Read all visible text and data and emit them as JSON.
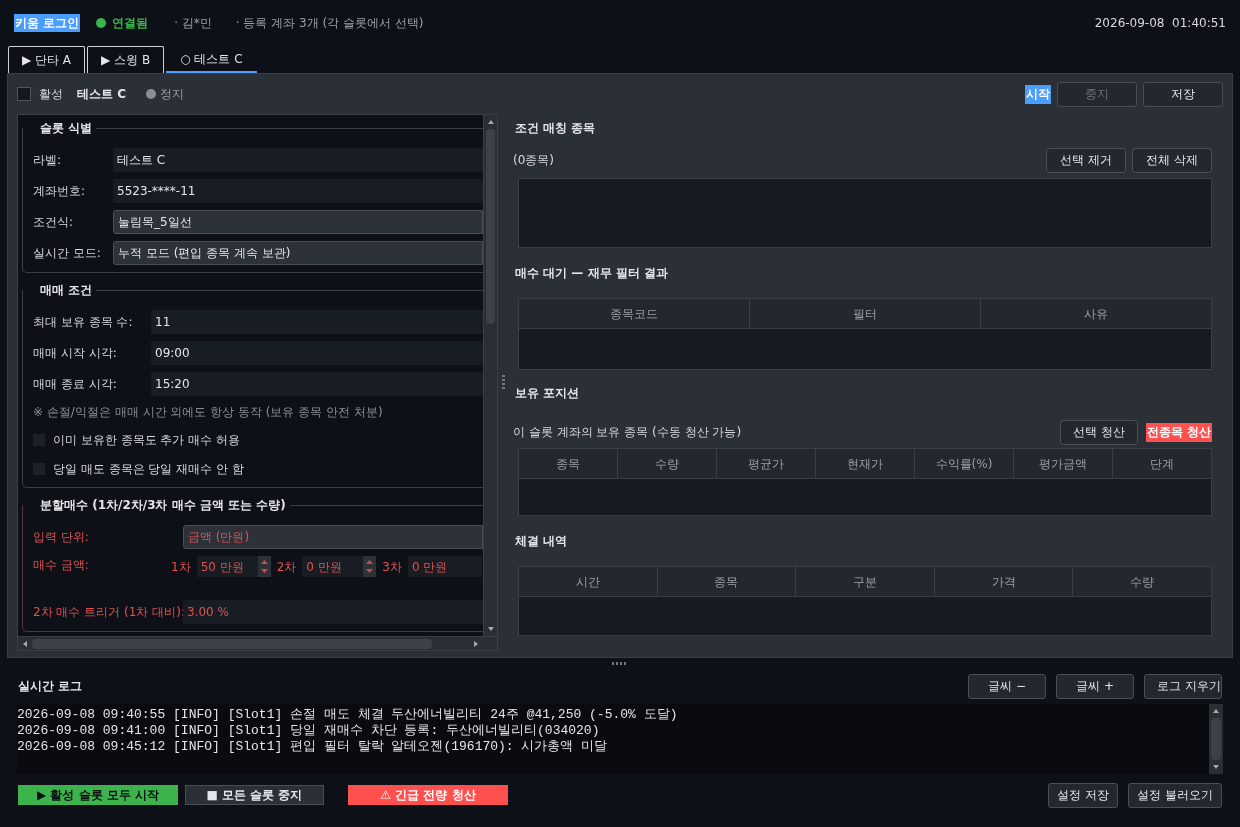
{
  "header": {
    "login_button": "키움 로그인",
    "connection": {
      "label": "연결됨",
      "connected": true
    },
    "user": "· 김*민",
    "accounts": "· 등록 계좌 3개 (각 슬롯에서 선택)",
    "datetime": "2026-09-08  01:40:51"
  },
  "tabs": [
    {
      "label": "▶ 단타 A",
      "selected": false
    },
    {
      "label": "▶ 스윙 B",
      "selected": false
    },
    {
      "label": "○ 테스트 C",
      "selected": true
    }
  ],
  "slot_bar": {
    "active": {
      "label": "활성",
      "checked": false
    },
    "name": "테스트 C",
    "status": {
      "label": "정지",
      "running": false
    },
    "buttons": [
      {
        "label": "시작",
        "kind": "highlight",
        "disabled": false
      },
      {
        "label": "중지",
        "kind": "normal",
        "disabled": true
      },
      {
        "label": "저장",
        "kind": "normal",
        "disabled": false
      }
    ]
  },
  "settings": [
    {
      "title": "슬롯 식별",
      "warning": false,
      "rows": [
        {
          "kind": "field",
          "label": "라벨:",
          "value": "테스트 C",
          "select": false
        },
        {
          "kind": "field",
          "label": "계좌번호:",
          "value": "5523-****-11",
          "select": false
        },
        {
          "kind": "field",
          "label": "조건식:",
          "value": "눌림목_5일선",
          "select": true
        },
        {
          "kind": "field",
          "label": "실시간 모드:",
          "value": "누적 모드 (편입 종목 계속 보관)",
          "select": true
        }
      ]
    },
    {
      "title": "매매 조건",
      "warning": false,
      "rows": [
        {
          "kind": "field",
          "label": "최대 보유 종목 수:",
          "value": "11",
          "select": false
        },
        {
          "kind": "field",
          "label": "매매 시작 시각:",
          "value": "09:00",
          "select": false
        },
        {
          "kind": "field",
          "label": "매매 종료 시각:",
          "value": "15:20",
          "select": false
        },
        {
          "kind": "note",
          "text": "※ 손절/익절은 매매 시간 외에도 항상 동작 (보유 종목 안전 처분)"
        },
        {
          "kind": "checkbox",
          "label": "이미 보유한 종목도 추가 매수 허용",
          "checked": false
        },
        {
          "kind": "checkbox",
          "label": "당일 매도 종목은 당일 재매수 안 함",
          "checked": false
        }
      ]
    },
    {
      "title": "분할매수 (1차/2차/3차 매수 금액 또는 수량)",
      "warning": true,
      "rows": [
        {
          "kind": "field",
          "label": "입력 단위:",
          "value": "금액 (만원)",
          "select": true
        },
        {
          "kind": "spins",
          "label": "매수 금액:",
          "spins": [
            {
              "label": "1차",
              "value": "50 만원"
            },
            {
              "label": "2차",
              "value": "0 만원"
            },
            {
              "label": "3차",
              "value": "0 만원"
            }
          ]
        },
        {
          "kind": "field",
          "label": "2차 매수 트리거 (1차 대비):",
          "value": "3.00 %",
          "select": false
        }
      ]
    }
  ],
  "matching": {
    "title": "조건 매칭 종목",
    "count": "(0종목)",
    "buttons": [
      "선택 제거",
      "전체 삭제"
    ]
  },
  "pending": {
    "title": "매수 대기 — 재무 필터 결과",
    "columns": [
      "종목코드",
      "필터",
      "사유"
    ]
  },
  "positions": {
    "title": "보유 포지션",
    "caption": "이 슬롯 계좌의 보유 종목 (수동 청산 가능)",
    "buttons": [
      {
        "label": "선택 청산",
        "kind": "normal"
      },
      {
        "label": "전종목 청산",
        "kind": "danger"
      }
    ],
    "columns": [
      "종목",
      "수량",
      "평균가",
      "현재가",
      "수익률(%)",
      "평가금액",
      "단계"
    ]
  },
  "executions": {
    "title": "체결 내역",
    "columns": [
      "시간",
      "종목",
      "구분",
      "가격",
      "수량"
    ]
  },
  "log": {
    "title": "실시간 로그",
    "buttons": [
      "글씨 −",
      "글씨 +",
      "로그 지우기"
    ],
    "lines": [
      "2026-09-08 09:40:55 [INFO] [Slot1] 손절 매도 체결 두산에너빌리티 24주 @41,250 (-5.0% 도달)",
      "2026-09-08 09:41:00 [INFO] [Slot1] 당일 재매수 차단 등록: 두산에너빌리티(034020)",
      "2026-09-08 09:45:12 [INFO] [Slot1] 편입 필터 탈락 알테오젠(196170): 시가총액 미달"
    ]
  },
  "footer": {
    "left": [
      {
        "label": "▶ 활성 슬롯 모두 시작",
        "kind": "start"
      },
      {
        "label": "■ 모든 슬롯 중지",
        "kind": "normal"
      },
      {
        "label": "⚠ 긴급 전량 청산",
        "kind": "danger"
      }
    ],
    "right": [
      "설정 저장",
      "설정 불러오기"
    ]
  }
}
